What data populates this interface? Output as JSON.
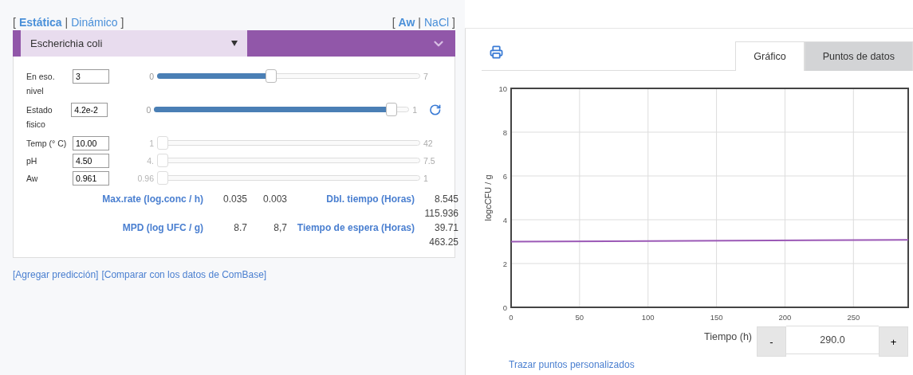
{
  "mode_switch": {
    "open": "[",
    "close": "]",
    "separator": "|",
    "options": [
      {
        "label": "Estática",
        "selected": true
      },
      {
        "label": "Dinámico",
        "selected": false
      }
    ]
  },
  "factor_switch": {
    "open": "[",
    "close": "]",
    "separator": "|",
    "options": [
      {
        "label": "Aw",
        "selected": true
      },
      {
        "label": "NaCl",
        "selected": false
      }
    ]
  },
  "organism_select": {
    "value": "Escherichia coli"
  },
  "parameters": [
    {
      "label": "En eso. nivel",
      "value": "3",
      "min": "0",
      "max": "7",
      "level": 0.43,
      "reset": false,
      "active": true
    },
    {
      "label": "Estado fisico",
      "value": "4.2e-2",
      "min": "0",
      "max": "1",
      "level": 0.95,
      "reset": true,
      "active": true
    },
    {
      "label": "Temp (° C)",
      "value": "10.00",
      "min": "1",
      "max": "42",
      "level": 0,
      "reset": false,
      "active": false
    },
    {
      "label": "pH",
      "value": "4.50",
      "min": "4.",
      "max": "7.5",
      "level": 0,
      "reset": false,
      "active": false
    },
    {
      "label": "Aw",
      "value": "0.961",
      "min": "0.96",
      "max": "1",
      "level": 0,
      "reset": false,
      "active": false
    }
  ],
  "results": [
    {
      "label": "Max.rate (log.conc / h)",
      "values": [
        "0.035",
        "0.003"
      ],
      "label2": "Dbl. tiempo (Horas)",
      "values2": [
        "8.545",
        "115.936"
      ]
    },
    {
      "label": "MPD (log UFC / g)",
      "values": [
        "8.7",
        "8,7"
      ],
      "label2": "Tiempo de espera (Horas)",
      "values2": [
        "39.71",
        "463.25"
      ]
    }
  ],
  "links": [
    "[Agregar predicción]",
    "[Comparar con los datos de ComBase]"
  ],
  "tabs": [
    {
      "label": "Gráfico",
      "selected": true
    },
    {
      "label": "Puntos de datos",
      "selected": false
    }
  ],
  "chart_data": {
    "type": "line",
    "ylabel": "logcCFU / g",
    "x": [
      0,
      290
    ],
    "grid": true,
    "series": [
      {
        "color": "#9b59b6",
        "values": [
          3.0,
          3.08
        ]
      }
    ],
    "xlim": [
      0,
      290
    ],
    "ylim": [
      0,
      10
    ],
    "xticks": [
      0,
      50,
      100,
      150,
      200,
      250
    ],
    "yticks": [
      0,
      2,
      4,
      6,
      8,
      10
    ]
  },
  "time_stepper": {
    "label": "Tiempo (h)",
    "minus": "-",
    "value": "290.0",
    "plus": "+"
  },
  "custom_points_link": "Trazar puntos personalizados"
}
